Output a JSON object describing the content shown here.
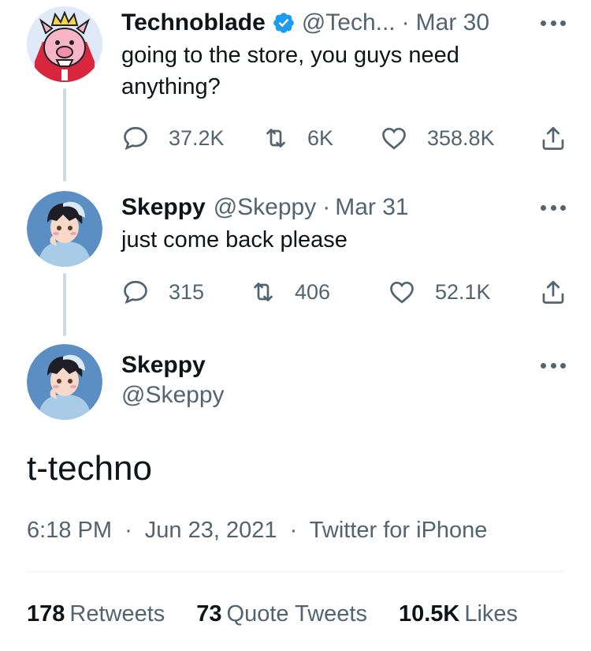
{
  "tweets": [
    {
      "name": "Technoblade",
      "verified": true,
      "handle": "@Tech...",
      "date": "Mar 30",
      "text": "going to the store, you guys need anything?",
      "replies": "37.2K",
      "retweets": "6K",
      "likes": "358.8K",
      "avatar_icon": "technoblade-pig-avatar"
    },
    {
      "name": "Skeppy",
      "verified": false,
      "handle": "@Skeppy",
      "date": "Mar 31",
      "text": "just come back please",
      "replies": "315",
      "retweets": "406",
      "likes": "52.1K",
      "avatar_icon": "skeppy-avatar"
    }
  ],
  "main_tweet": {
    "name": "Skeppy",
    "handle": "@Skeppy",
    "text": "t-techno",
    "time": "6:18 PM",
    "date": "Jun 23, 2021",
    "source": "Twitter for iPhone",
    "retweets_count": "178",
    "retweets_label": "Retweets",
    "quotes_count": "73",
    "quotes_label": "Quote Tweets",
    "likes_count": "10.5K",
    "likes_label": "Likes"
  },
  "separator": "·",
  "colors": {
    "text": "#0f1419",
    "secondary": "#536471",
    "verified": "#1d9bf0",
    "thread_line": "#cfd9de",
    "avatar_bg": "#5b8fc4"
  }
}
